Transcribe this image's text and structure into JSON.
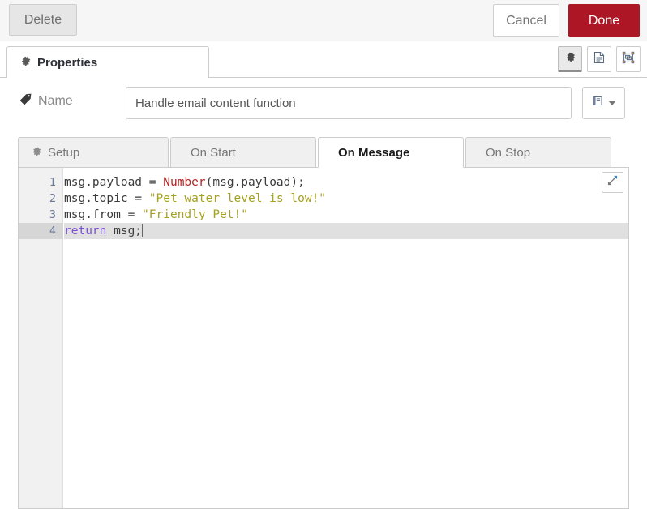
{
  "header": {
    "delete_label": "Delete",
    "cancel_label": "Cancel",
    "done_label": "Done",
    "done_color": "#ad1625"
  },
  "tabstrip": {
    "properties_label": "Properties",
    "properties_icon": "gear-icon",
    "icon_buttons": [
      {
        "name": "gear-icon",
        "label": "Properties",
        "active": true
      },
      {
        "name": "description-icon",
        "label": "Description",
        "active": false
      },
      {
        "name": "appearance-icon",
        "label": "Appearance",
        "active": false
      }
    ]
  },
  "name_row": {
    "label": "Name",
    "label_icon": "tag-icon",
    "value": "Handle email content function",
    "placeholder": "Name",
    "book_button_icon": "book-icon"
  },
  "subtabs": [
    {
      "label": "Setup",
      "icon": "gear-icon",
      "active": false
    },
    {
      "label": "On Start",
      "icon": null,
      "active": false
    },
    {
      "label": "On Message",
      "icon": null,
      "active": true
    },
    {
      "label": "On Stop",
      "icon": null,
      "active": false
    }
  ],
  "editor": {
    "expand_icon": "expand-icon",
    "active_line": 4,
    "gutter": [
      "1",
      "2",
      "3",
      "4"
    ],
    "lines": [
      {
        "num": "1",
        "tokens": [
          {
            "t": "msg.payload ",
            "c": "tok-plain"
          },
          {
            "t": "= ",
            "c": "tok-op"
          },
          {
            "t": "Number",
            "c": "tok-fn"
          },
          {
            "t": "(msg.payload);",
            "c": "tok-plain"
          }
        ]
      },
      {
        "num": "2",
        "tokens": [
          {
            "t": "msg.topic ",
            "c": "tok-plain"
          },
          {
            "t": "= ",
            "c": "tok-op"
          },
          {
            "t": "\"Pet water level is low!\"",
            "c": "tok-str"
          }
        ]
      },
      {
        "num": "3",
        "tokens": [
          {
            "t": "msg.from ",
            "c": "tok-plain"
          },
          {
            "t": "= ",
            "c": "tok-op"
          },
          {
            "t": "\"Friendly Pet!\"",
            "c": "tok-str"
          }
        ]
      },
      {
        "num": "4",
        "tokens": [
          {
            "t": "return",
            "c": "tok-kw"
          },
          {
            "t": " msg;",
            "c": "tok-plain"
          }
        ]
      }
    ]
  }
}
